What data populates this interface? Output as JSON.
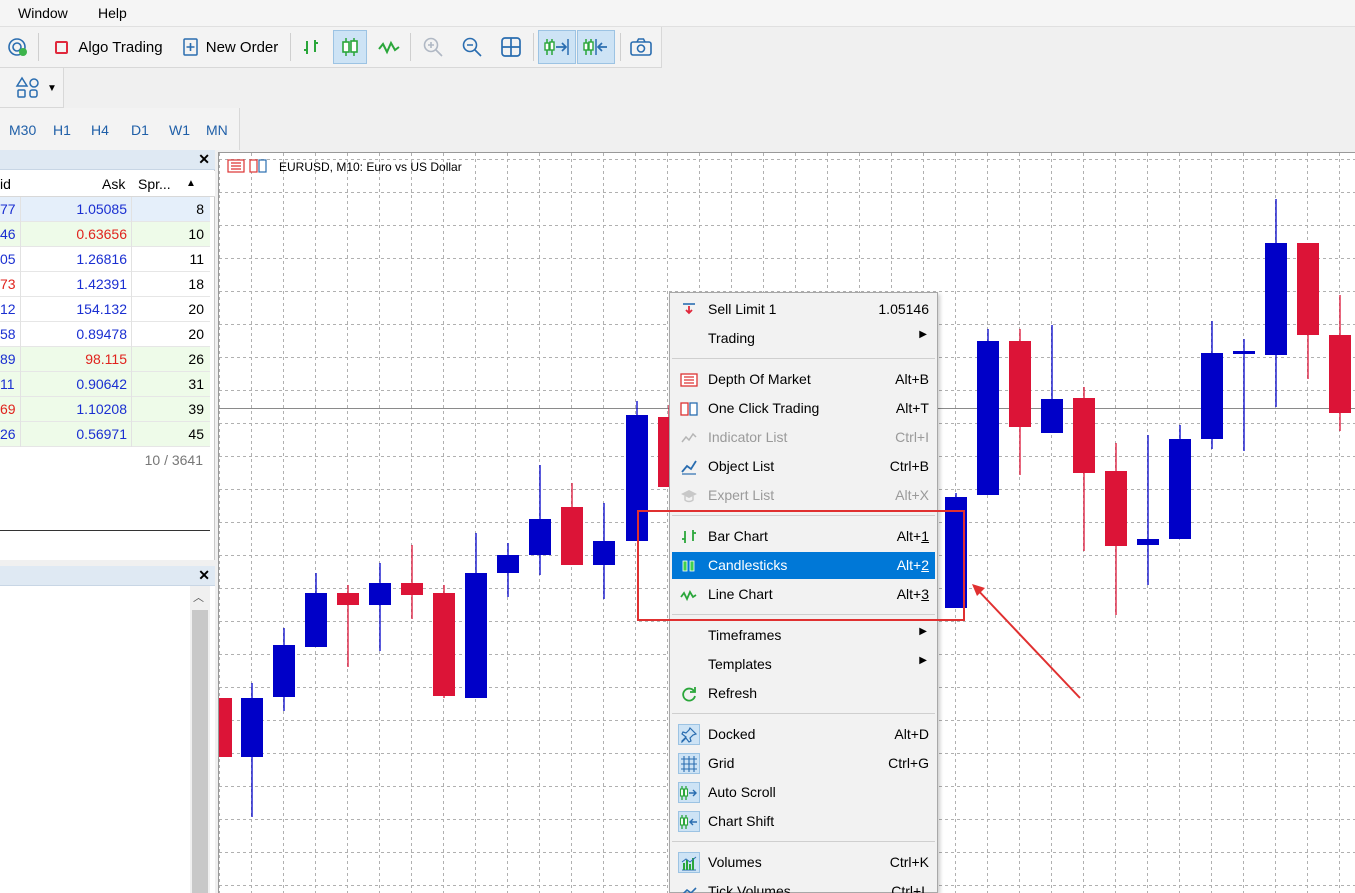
{
  "menu": [
    "Window",
    "Help"
  ],
  "toolbar": {
    "algo_trading": "Algo Trading",
    "new_order": "New Order"
  },
  "timeframes": [
    "M30",
    "H1",
    "H4",
    "D1",
    "W1",
    "MN"
  ],
  "market_watch": {
    "columns": [
      "id",
      "Ask",
      "Spr..."
    ],
    "rows": [
      {
        "bid": "77",
        "ask": "1.05085",
        "spread": "8",
        "bid_color": "blue",
        "ask_color": "blue",
        "bg": "#e5effa"
      },
      {
        "bid": "46",
        "ask": "0.63656",
        "spread": "10",
        "bid_color": "blue",
        "ask_color": "red",
        "bg": "#eefbe9"
      },
      {
        "bid": "05",
        "ask": "1.26816",
        "spread": "11",
        "bid_color": "blue",
        "ask_color": "blue",
        "bg": "#ffffff"
      },
      {
        "bid": "73",
        "ask": "1.42391",
        "spread": "18",
        "bid_color": "red",
        "ask_color": "blue",
        "bg": "#ffffff"
      },
      {
        "bid": "12",
        "ask": "154.132",
        "spread": "20",
        "bid_color": "blue",
        "ask_color": "blue",
        "bg": "#ffffff"
      },
      {
        "bid": "58",
        "ask": "0.89478",
        "spread": "20",
        "bid_color": "blue",
        "ask_color": "blue",
        "bg": "#ffffff"
      },
      {
        "bid": "89",
        "ask": "98.115",
        "spread": "26",
        "bid_color": "blue",
        "ask_color": "red",
        "bg": "#eefbe9"
      },
      {
        "bid": "11",
        "ask": "0.90642",
        "spread": "31",
        "bid_color": "blue",
        "ask_color": "blue",
        "bg": "#eefbe9"
      },
      {
        "bid": "69",
        "ask": "1.10208",
        "spread": "39",
        "bid_color": "red",
        "ask_color": "blue",
        "bg": "#eefbe9"
      },
      {
        "bid": "26",
        "ask": "0.56971",
        "spread": "45",
        "bid_color": "blue",
        "ask_color": "blue",
        "bg": "#eefbe9"
      }
    ],
    "count": "10 / 3641"
  },
  "chart": {
    "title": "EURUSD, M10:  Euro vs US Dollar",
    "colors": {
      "bull": "#0000c8",
      "bear": "#dc1437",
      "grid": "#b0b0b0"
    }
  },
  "context_menu": {
    "items": [
      {
        "name": "sell-limit",
        "label": "Sell Limit 1",
        "shortcut": "1.05146",
        "icon": "sell-limit-icon"
      },
      {
        "name": "trading",
        "label": "Trading",
        "submenu": true
      },
      {
        "name": "depth-of-market",
        "label": "Depth Of Market",
        "shortcut": "Alt+B",
        "icon": "depth-of-market-icon"
      },
      {
        "name": "one-click-trading",
        "label": "One Click Trading",
        "shortcut": "Alt+T",
        "icon": "one-click-trading-icon"
      },
      {
        "name": "indicator-list",
        "label": "Indicator List",
        "shortcut": "Ctrl+I",
        "icon": "indicator-list-icon",
        "disabled": true
      },
      {
        "name": "object-list",
        "label": "Object List",
        "shortcut": "Ctrl+B",
        "icon": "object-list-icon"
      },
      {
        "name": "expert-list",
        "label": "Expert List",
        "shortcut": "Alt+X",
        "icon": "expert-list-icon",
        "disabled": true
      },
      {
        "name": "bar-chart",
        "label": "Bar Chart",
        "shortcut": "Alt+",
        "shortcut_key": "1",
        "icon": "bar-chart-icon"
      },
      {
        "name": "candlesticks",
        "label": "Candlesticks",
        "shortcut": "Alt+",
        "shortcut_key": "2",
        "icon": "candlesticks-icon",
        "selected": true
      },
      {
        "name": "line-chart",
        "label": "Line Chart",
        "shortcut": "Alt+",
        "shortcut_key": "3",
        "icon": "line-chart-icon"
      },
      {
        "name": "timeframes",
        "label": "Timeframes",
        "submenu": true
      },
      {
        "name": "templates",
        "label": "Templates",
        "submenu": true
      },
      {
        "name": "refresh",
        "label": "Refresh",
        "icon": "refresh-icon"
      },
      {
        "name": "docked",
        "label": "Docked",
        "shortcut": "Alt+D",
        "icon": "pin-icon"
      },
      {
        "name": "grid",
        "label": "Grid",
        "shortcut": "Ctrl+G",
        "icon": "grid-icon"
      },
      {
        "name": "auto-scroll",
        "label": "Auto Scroll",
        "icon": "auto-scroll-icon"
      },
      {
        "name": "chart-shift",
        "label": "Chart Shift",
        "icon": "chart-shift-icon"
      },
      {
        "name": "volumes",
        "label": "Volumes",
        "shortcut": "Ctrl+K",
        "icon": "volumes-icon"
      },
      {
        "name": "tick-volumes",
        "label": "Tick Volumes",
        "shortcut": "Ctrl+L",
        "icon": "tick-volumes-icon"
      }
    ]
  }
}
